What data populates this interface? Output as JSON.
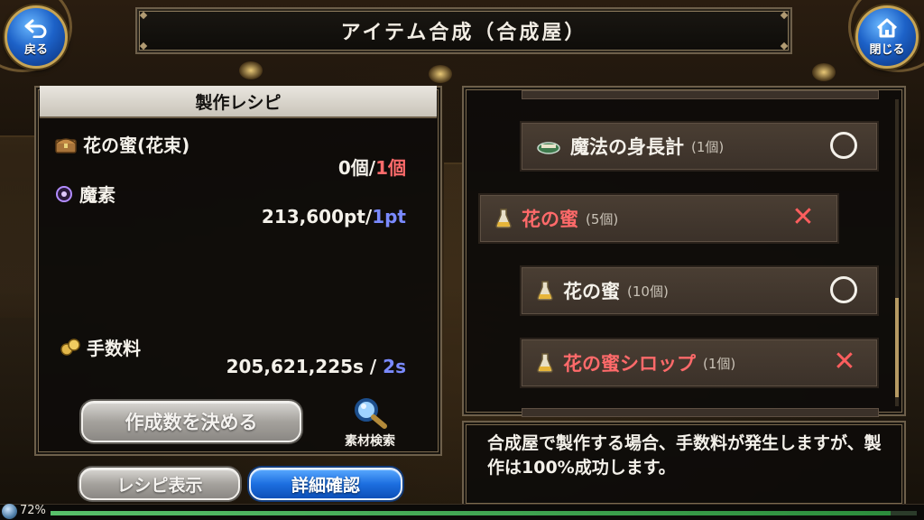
{
  "header": {
    "title": "アイテム合成（合成屋）",
    "back_label": "戻る",
    "close_label": "閉じる"
  },
  "recipe": {
    "panel_title": "製作レシピ",
    "items": [
      {
        "name": "花の蜜(花束)",
        "icon": "chest-icon",
        "have": "0個",
        "sep": "/",
        "need": "1個",
        "need_color": "#ff6b6b"
      },
      {
        "name": "魔素",
        "icon": "purple-orb-icon",
        "have": "213,600pt",
        "sep": "/",
        "need": "1pt",
        "need_color": "#7a8aff"
      }
    ],
    "fee": {
      "label": "手数料",
      "icon": "coins-icon",
      "have": "205,621,225s",
      "sep": " / ",
      "need": "2s",
      "need_color": "#7a8aff"
    },
    "decide_button": "作成数を決める",
    "search_label": "素材検索"
  },
  "bottom_buttons": {
    "recipe_view": "レシピ表示",
    "detail_check": "詳細確認"
  },
  "material_list": [
    {
      "name": "魔法の身長計",
      "qty": "(1個)",
      "icon": "measure-icon",
      "status": "ok",
      "name_color": "normal"
    },
    {
      "name": "花の蜜",
      "qty": "(5個)",
      "icon": "flask-icon",
      "status": "ng",
      "name_color": "red"
    },
    {
      "name": "花の蜜",
      "qty": "(10個)",
      "icon": "flask-icon",
      "status": "ok",
      "name_color": "normal"
    },
    {
      "name": "花の蜜シロップ",
      "qty": "(1個)",
      "icon": "flask-icon",
      "status": "ng",
      "name_color": "red"
    }
  ],
  "info": {
    "text": "合成屋で製作する場合、手数料が発生しますが、製作は100%成功します。"
  },
  "status": {
    "percent": "72%",
    "hp_fraction": 0.97
  },
  "colors": {
    "panel_border": "#6d5f4a",
    "ok_mark": "#f4f1ea",
    "ng_mark": "#ff5e5e",
    "accent_blue": "#1d6fe0"
  }
}
